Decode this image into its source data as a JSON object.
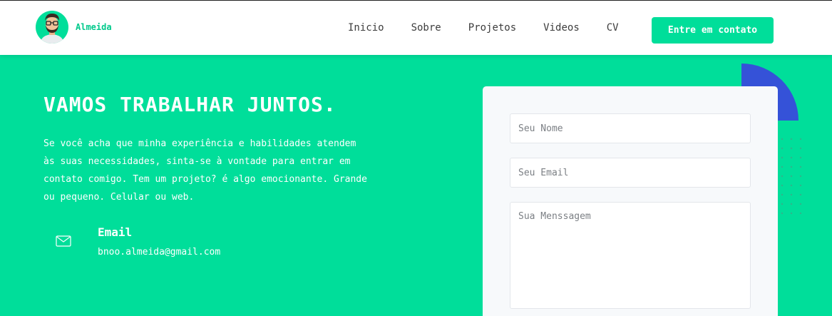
{
  "header": {
    "brand_name": "Almeida",
    "nav": [
      {
        "label": "Inicio"
      },
      {
        "label": "Sobre"
      },
      {
        "label": "Projetos"
      },
      {
        "label": "Videos"
      },
      {
        "label": "CV"
      }
    ],
    "cta_label": "Entre em contato"
  },
  "contact": {
    "title": "VAMOS TRABALHAR JUNTOS.",
    "description": "Se você acha que minha experiência e habilidades atendem às suas necessidades, sinta-se à vontade para entrar em contato comigo. Tem um projeto? é algo emocionante. Grande ou pequeno. Celular ou web.",
    "email_label": "Email",
    "email_value": "bnoo.almeida@gmail.com",
    "icon": "mail-icon"
  },
  "form": {
    "name_placeholder": "Seu Nome",
    "email_placeholder": "Seu Email",
    "message_placeholder": "Sua Menssagem"
  },
  "colors": {
    "accent": "#00de9a",
    "deco_blue": "#3552d8",
    "card_bg": "#f7f9fb"
  }
}
